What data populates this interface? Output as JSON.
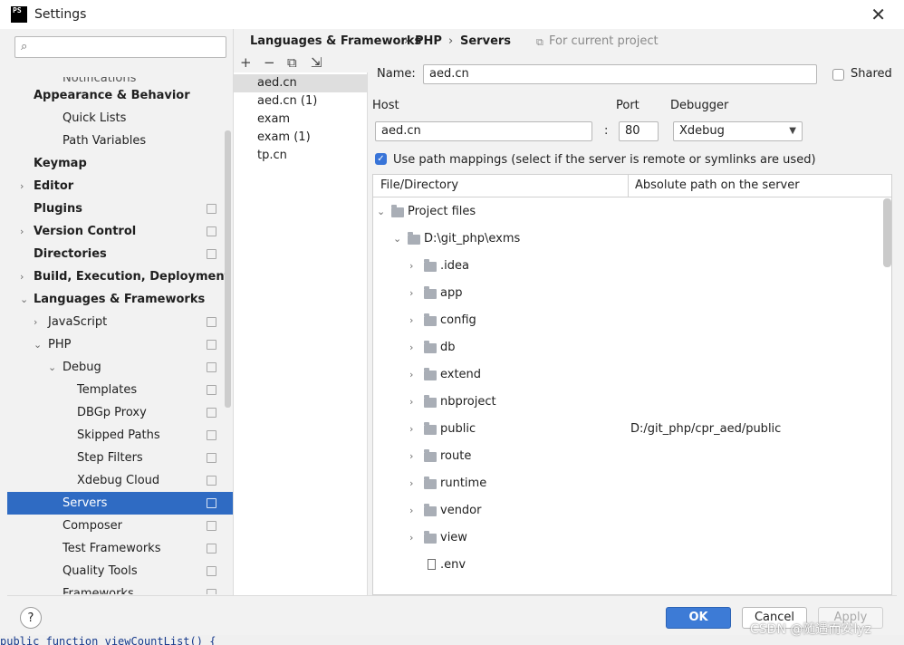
{
  "window": {
    "icon_text": "PS",
    "title": "Settings",
    "close_label": "✕"
  },
  "search": {
    "placeholder": "",
    "icon": "search-icon"
  },
  "sidebar": {
    "items": [
      {
        "label": "Notifications",
        "indent": 3,
        "bold": false,
        "arrow": "",
        "pin": false,
        "partial": true
      },
      {
        "label": "Appearance & Behavior",
        "indent": 1,
        "bold": true,
        "arrow": "",
        "pin": false
      },
      {
        "label": "Quick Lists",
        "indent": 3,
        "bold": false,
        "arrow": "",
        "pin": false
      },
      {
        "label": "Path Variables",
        "indent": 3,
        "bold": false,
        "arrow": "",
        "pin": false
      },
      {
        "label": "Keymap",
        "indent": 1,
        "bold": true,
        "arrow": "",
        "pin": false
      },
      {
        "label": "Editor",
        "indent": 1,
        "bold": true,
        "arrow": "›",
        "pin": false
      },
      {
        "label": "Plugins",
        "indent": 1,
        "bold": true,
        "arrow": "",
        "pin": true
      },
      {
        "label": "Version Control",
        "indent": 1,
        "bold": true,
        "arrow": "›",
        "pin": true
      },
      {
        "label": "Directories",
        "indent": 1,
        "bold": true,
        "arrow": "",
        "pin": true
      },
      {
        "label": "Build, Execution, Deployment",
        "indent": 1,
        "bold": true,
        "arrow": "›",
        "pin": false
      },
      {
        "label": "Languages & Frameworks",
        "indent": 1,
        "bold": true,
        "arrow": "⌄",
        "pin": false
      },
      {
        "label": "JavaScript",
        "indent": 2,
        "bold": false,
        "arrow": "›",
        "pin": true
      },
      {
        "label": "PHP",
        "indent": 2,
        "bold": false,
        "arrow": "⌄",
        "pin": true
      },
      {
        "label": "Debug",
        "indent": 3,
        "bold": false,
        "arrow": "⌄",
        "pin": true
      },
      {
        "label": "Templates",
        "indent": 4,
        "bold": false,
        "arrow": "",
        "pin": true
      },
      {
        "label": "DBGp Proxy",
        "indent": 4,
        "bold": false,
        "arrow": "",
        "pin": true
      },
      {
        "label": "Skipped Paths",
        "indent": 4,
        "bold": false,
        "arrow": "",
        "pin": true
      },
      {
        "label": "Step Filters",
        "indent": 4,
        "bold": false,
        "arrow": "",
        "pin": true
      },
      {
        "label": "Xdebug Cloud",
        "indent": 4,
        "bold": false,
        "arrow": "",
        "pin": true
      },
      {
        "label": "Servers",
        "indent": 3,
        "bold": false,
        "arrow": "",
        "pin": true,
        "selected": true
      },
      {
        "label": "Composer",
        "indent": 3,
        "bold": false,
        "arrow": "",
        "pin": true
      },
      {
        "label": "Test Frameworks",
        "indent": 3,
        "bold": false,
        "arrow": "",
        "pin": true
      },
      {
        "label": "Quality Tools",
        "indent": 3,
        "bold": false,
        "arrow": "",
        "pin": true
      },
      {
        "label": "Frameworks",
        "indent": 3,
        "bold": false,
        "arrow": "",
        "pin": true
      }
    ]
  },
  "breadcrumb": {
    "parts": [
      "Languages & Frameworks",
      "PHP",
      "Servers"
    ],
    "separator": "›",
    "scope_label": "For current project"
  },
  "toolbar": {
    "add": "+",
    "remove": "−",
    "copy": "⧉",
    "import": "⇲"
  },
  "servers": {
    "items": [
      "aed.cn",
      "aed.cn (1)",
      "exam",
      "exam (1)",
      "tp.cn"
    ],
    "selected_index": 0
  },
  "form": {
    "name_label": "Name:",
    "name_value": "aed.cn",
    "shared_label": "Shared",
    "shared_checked": false,
    "host_label": "Host",
    "host_value": "aed.cn",
    "port_label": "Port",
    "port_sep": ":",
    "port_value": "80",
    "debugger_label": "Debugger",
    "debugger_value": "Xdebug",
    "use_mappings_label": "Use path mappings (select if the server is remote or symlinks are used)",
    "use_mappings_checked": true
  },
  "mappings": {
    "col_file": "File/Directory",
    "col_server": "Absolute path on the server",
    "rows": [
      {
        "name": "Project files",
        "depth": 0,
        "type": "folder",
        "expanded": true,
        "server": ""
      },
      {
        "name": "D:\\git_php\\exms",
        "depth": 1,
        "type": "folder",
        "expanded": true,
        "server": ""
      },
      {
        "name": ".idea",
        "depth": 2,
        "type": "folder",
        "expanded": false,
        "server": ""
      },
      {
        "name": "app",
        "depth": 2,
        "type": "folder",
        "expanded": false,
        "server": ""
      },
      {
        "name": "config",
        "depth": 2,
        "type": "folder",
        "expanded": false,
        "server": ""
      },
      {
        "name": "db",
        "depth": 2,
        "type": "folder",
        "expanded": false,
        "server": ""
      },
      {
        "name": "extend",
        "depth": 2,
        "type": "folder",
        "expanded": false,
        "server": ""
      },
      {
        "name": "nbproject",
        "depth": 2,
        "type": "folder",
        "expanded": false,
        "server": ""
      },
      {
        "name": "public",
        "depth": 2,
        "type": "folder",
        "expanded": false,
        "server": "D:/git_php/cpr_aed/public"
      },
      {
        "name": "route",
        "depth": 2,
        "type": "folder",
        "expanded": false,
        "server": ""
      },
      {
        "name": "runtime",
        "depth": 2,
        "type": "folder",
        "expanded": false,
        "server": ""
      },
      {
        "name": "vendor",
        "depth": 2,
        "type": "folder",
        "expanded": false,
        "server": ""
      },
      {
        "name": "view",
        "depth": 2,
        "type": "folder",
        "expanded": false,
        "server": ""
      },
      {
        "name": ".env",
        "depth": 2,
        "type": "file",
        "expanded": false,
        "server": ""
      }
    ]
  },
  "footer": {
    "help_label": "?",
    "ok_label": "OK",
    "cancel_label": "Cancel",
    "apply_label": "Apply"
  },
  "background_code": "    public function viewCountList() {",
  "watermark": "CSDN @随遇而安lyz",
  "colors": {
    "selection": "#2f6bc3",
    "ok_button": "#3d7bd6",
    "checkbox_on": "#3874d8"
  }
}
